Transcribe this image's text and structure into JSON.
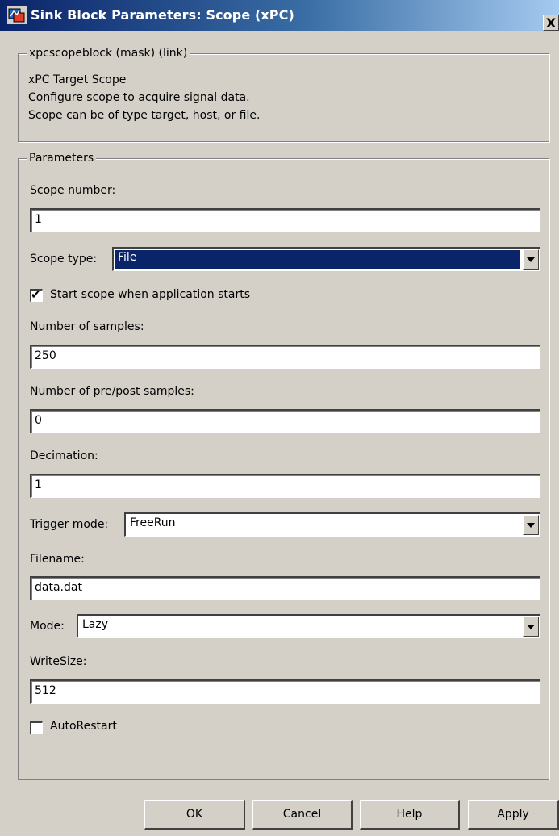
{
  "window": {
    "title": "Sink Block Parameters: Scope (xPC)",
    "close_label": "X"
  },
  "mask": {
    "group_label": "xpcscopeblock (mask) (link)",
    "description": [
      "xPC Target Scope",
      "Configure scope to acquire signal data.",
      "Scope can be of type target, host, or file."
    ]
  },
  "parameters": {
    "group_label": "Parameters",
    "scope_number": {
      "label": "Scope number:",
      "value": "1"
    },
    "scope_type": {
      "label": "Scope type:",
      "value": "File"
    },
    "start_scope": {
      "label": "Start scope when application starts",
      "checked": true,
      "mark": "✔"
    },
    "num_samples": {
      "label": "Number of samples:",
      "value": "250"
    },
    "num_prepost": {
      "label": "Number of pre/post samples:",
      "value": "0"
    },
    "decimation": {
      "label": "Decimation:",
      "value": "1"
    },
    "trigger_mode": {
      "label": "Trigger mode:",
      "value": "FreeRun"
    },
    "filename": {
      "label": "Filename:",
      "value": "data.dat"
    },
    "mode": {
      "label": "Mode:",
      "value": "Lazy"
    },
    "writesize": {
      "label": "WriteSize:",
      "value": "512"
    },
    "autorestart": {
      "label": "AutoRestart",
      "checked": false
    }
  },
  "buttons": {
    "ok": "OK",
    "cancel": "Cancel",
    "help": "Help",
    "apply": "Apply"
  },
  "colors": {
    "dialog_bg": "#d4d0c8",
    "title_start": "#0a246a",
    "title_end": "#a6caf0",
    "selection": "#0a246a"
  }
}
